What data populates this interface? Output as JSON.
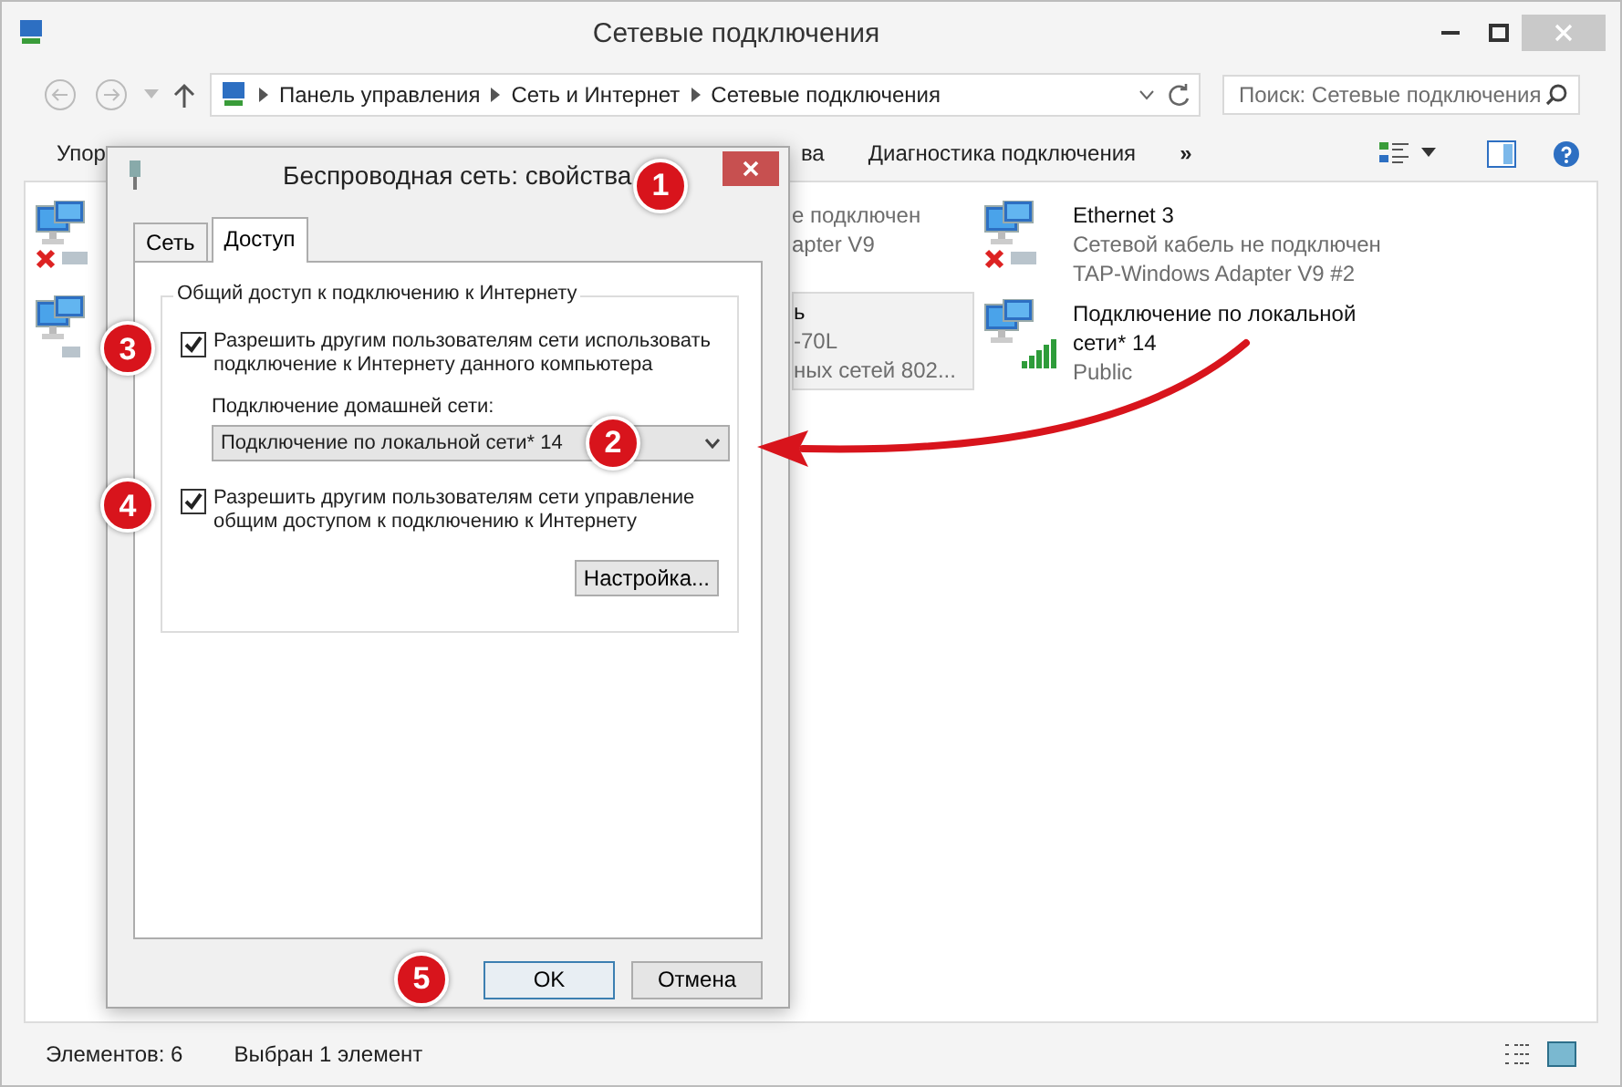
{
  "window": {
    "title": "Сетевые подключения"
  },
  "address": {
    "crumbs": [
      "Панель управления",
      "Сеть и Интернет",
      "Сетевые подключения"
    ]
  },
  "search": {
    "placeholder": "Поиск: Сетевые подключения"
  },
  "toolbar": {
    "left": "Упор",
    "partial": "ва",
    "diagnose": "Диагностика подключения",
    "more": "»"
  },
  "columns": [
    [
      {
        "kind": "disconnected",
        "selected": false
      },
      {
        "kind": "wired",
        "selected": false
      }
    ],
    [
      {
        "lines": [
          "е подключен",
          "apter V9"
        ],
        "selected": false
      },
      {
        "name": "ь",
        "lines": [
          "-70L",
          "ных сетей 802..."
        ],
        "selected": true
      }
    ],
    [
      {
        "kind": "disconnected",
        "name": "Ethernet 3",
        "lines": [
          "Сетевой кабель не подключен",
          "TAP-Windows Adapter V9 #2"
        ],
        "selected": false
      },
      {
        "kind": "signal",
        "name": "Подключение по локальной сети* 14",
        "lines": [
          "Public"
        ],
        "selected": false
      }
    ]
  ],
  "status_bar": {
    "count": "Элементов: 6",
    "selection": "Выбран 1 элемент"
  },
  "dialog": {
    "title": "Беспроводная сеть: свойства",
    "title_marker": "1",
    "tabs": [
      {
        "label": "Сеть",
        "selected": false
      },
      {
        "label": "Доступ",
        "selected": true
      }
    ],
    "legend": "Общий доступ к подключению к Интернету",
    "share": {
      "label": "Разрешить другим пользователям сети использовать подключение к Интернету данного компьютера",
      "checked": true,
      "marker": "3"
    },
    "home": {
      "label": "Подключение домашней сети:",
      "value": "Подключение по локальной сети* 14",
      "marker": "2"
    },
    "control": {
      "label": "Разрешить другим пользователям сети управление общим доступом к подключению к Интернету",
      "checked": true,
      "marker": "4"
    },
    "settings_button": "Настройка...",
    "buttons_marker": "5",
    "buttons": [
      {
        "label": "OK",
        "default": true
      },
      {
        "label": "Отмена",
        "default": false
      }
    ]
  }
}
